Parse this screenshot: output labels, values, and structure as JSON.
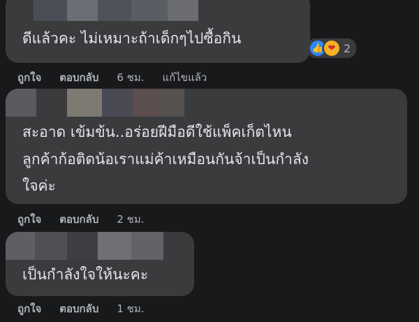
{
  "comments": [
    {
      "text_lines": [
        "ดีแล้วคะ ไม่เหมาะถ้าเด็กๆไปซื้อกิน"
      ],
      "reactions": {
        "icons": [
          "like-icon",
          "care-icon"
        ],
        "count": "2"
      },
      "actions": {
        "like": "ถูกใจ",
        "reply": "ตอบกลับ",
        "time": "6 ชม.",
        "edited": "แก้ไขแล้ว"
      }
    },
    {
      "text_lines": [
        "สะอาด เข้มข้น..อร่อยฝีมือดีใช้แพ็คเก็ตไหน",
        "ลูกค้าก้อติดน้อเราแม่ค้าเหมือนกันจ้าเป็นกำลัง",
        "ใจค่ะ"
      ],
      "actions": {
        "like": "ถูกใจ",
        "reply": "ตอบกลับ",
        "time": "2 ชม."
      }
    },
    {
      "text_lines": [
        "เป็นกำลังใจให้นะคะ"
      ],
      "actions": {
        "like": "ถูกใจ",
        "reply": "ตอบกลับ",
        "time": "1 ชม."
      }
    }
  ],
  "colors": {
    "background": "#18191a",
    "bubble": "#3a3b3c",
    "text": "#e4e6eb",
    "secondary_text": "#b0b3b8",
    "like_blue": "#2d88ff",
    "care_yellow": "#f7b125"
  }
}
